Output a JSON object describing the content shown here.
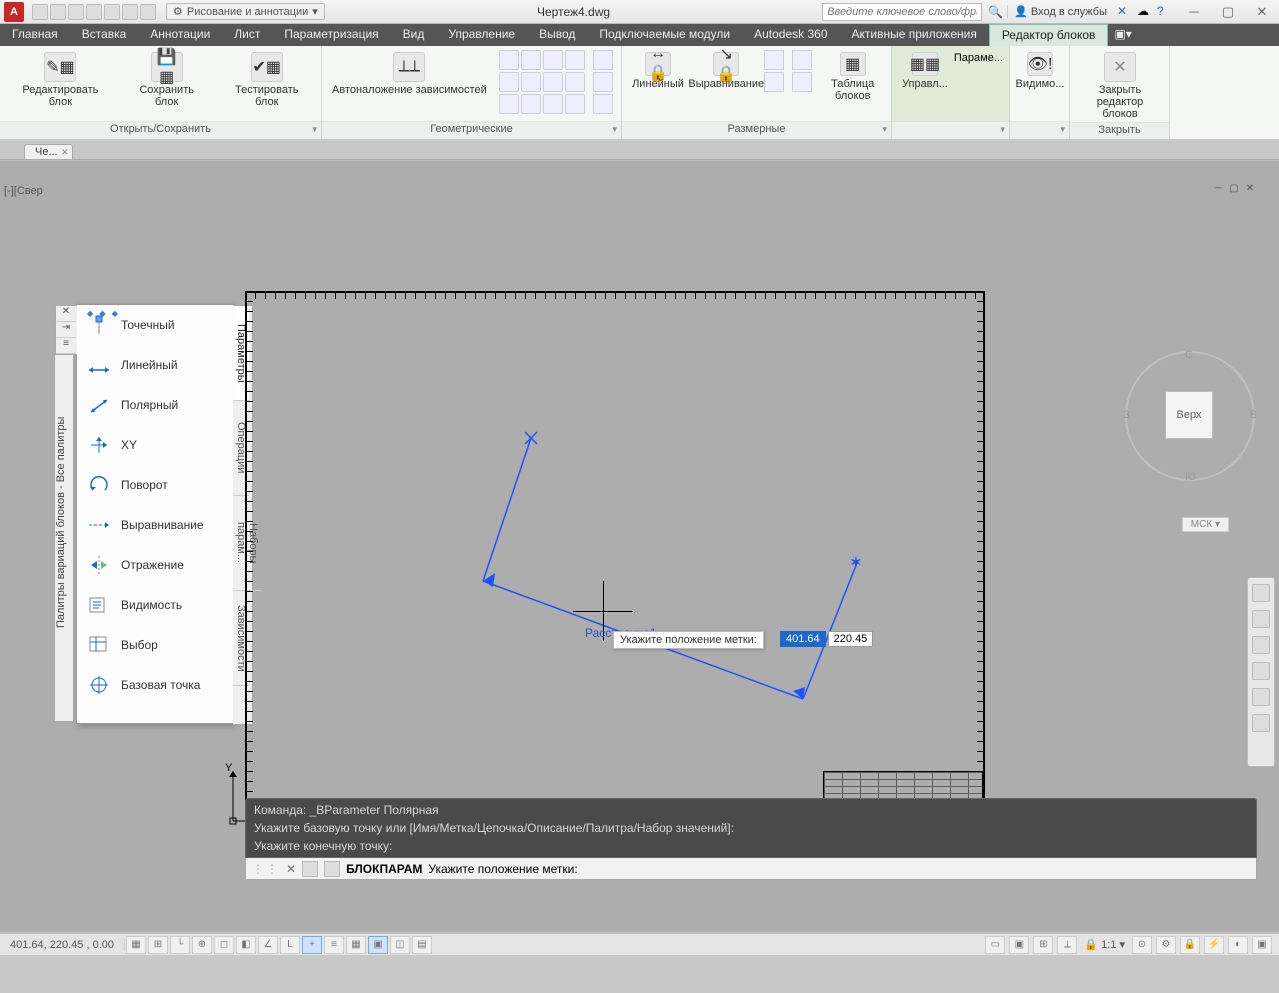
{
  "titlebar": {
    "workspace": "Рисование и аннотации",
    "filename": "Чертеж4.dwg",
    "search_placeholder": "Введите ключевое слово/фразу",
    "login": "Вход в службы"
  },
  "tabs": [
    "Главная",
    "Вставка",
    "Аннотации",
    "Лист",
    "Параметризация",
    "Вид",
    "Управление",
    "Вывод",
    "Подключаемые модули",
    "Autodesk 360",
    "Активные приложения",
    "Редактор блоков"
  ],
  "active_tab": "Редактор блоков",
  "ribbon": {
    "panels": [
      {
        "id": "open_save",
        "footer": "Открыть/Сохранить",
        "buttons": [
          "Редактировать блок",
          "Сохранить блок",
          "Тестировать блок"
        ]
      },
      {
        "id": "geo",
        "footer": "Геометрические",
        "buttons": [
          "Автоналожение зависимостей"
        ]
      },
      {
        "id": "dim",
        "footer": "Размерные",
        "buttons": [
          "Линейный",
          "Выравнивание",
          "Таблица блоков"
        ]
      },
      {
        "id": "manage",
        "footer": "",
        "buttons": [
          "Управл...",
          "Параме..."
        ],
        "highlight": true
      },
      {
        "id": "vis",
        "footer": "",
        "buttons": [
          "Видимо..."
        ]
      },
      {
        "id": "close",
        "footer": "Закрыть",
        "buttons": [
          "Закрыть редактор блоков"
        ]
      }
    ],
    "dim_small_icons": 4
  },
  "file_tab": "Че...",
  "viewport_label": "[-][Свер",
  "palette_title": "Палитры вариаций блоков - Все палитры",
  "param_tabs": [
    "Параметры",
    "Операции",
    "Наборы парам...",
    "Зависимости"
  ],
  "active_param_tab": "Параметры",
  "param_items": [
    {
      "name": "Точечный",
      "icon": "point"
    },
    {
      "name": "Линейный",
      "icon": "linear"
    },
    {
      "name": "Полярный",
      "icon": "polar"
    },
    {
      "name": "XY",
      "icon": "xy"
    },
    {
      "name": "Поворот",
      "icon": "rotate"
    },
    {
      "name": "Выравнивание",
      "icon": "align"
    },
    {
      "name": "Отражение",
      "icon": "flip"
    },
    {
      "name": "Видимость",
      "icon": "visibility"
    },
    {
      "name": "Выбор",
      "icon": "lookup"
    },
    {
      "name": "Базовая точка",
      "icon": "basepoint"
    }
  ],
  "viewcube": {
    "face": "Верх",
    "n": "С",
    "s": "Ю",
    "e": "В",
    "w": "З"
  },
  "ucs": "МСК",
  "drawing": {
    "param_name": "Расстояние1",
    "prompt": "Укажите положение метки:",
    "coord_x": "401.64",
    "coord_y": "220.45"
  },
  "cmd": {
    "hist1": "Команда: _BParameter Полярная",
    "hist2": "Укажите базовую точку или [Имя/Метка/Цепочка/Описание/Палитра/Набор значений]:",
    "hist3": "Укажите конечную точку:",
    "label": "БЛОКПАРАМ",
    "prompt": "Укажите положение метки:"
  },
  "status": {
    "coords": "401.64, 220.45 , 0.00",
    "scale": "1:1"
  }
}
